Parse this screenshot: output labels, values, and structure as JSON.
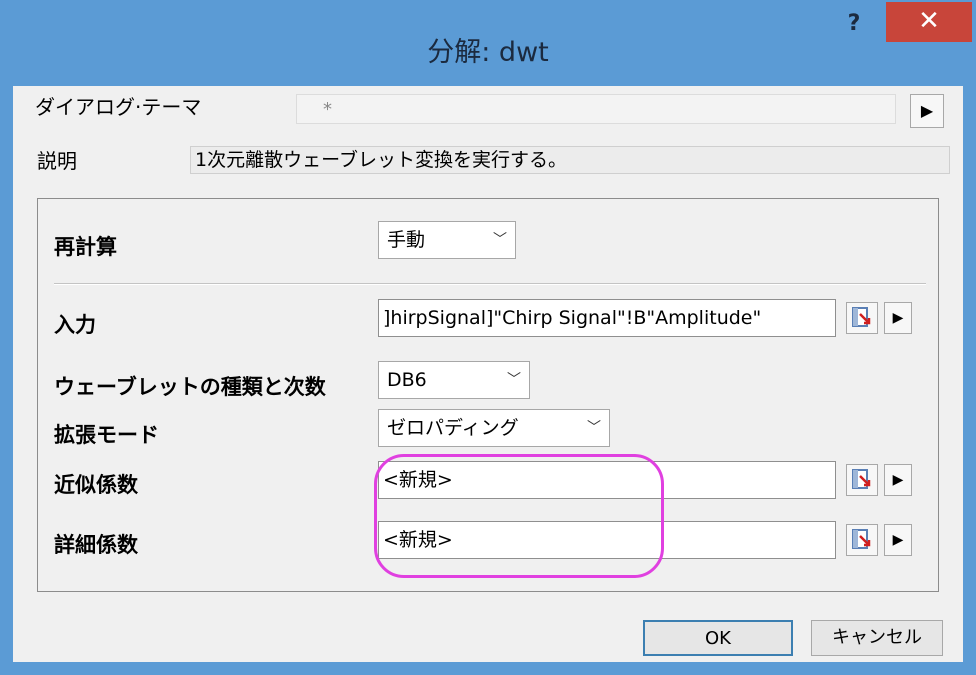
{
  "window": {
    "title": "分解: dwt",
    "help_label": "?",
    "close_label": "✕"
  },
  "theme": {
    "label": "ダイアログ·テーマ",
    "value": "*",
    "arrow": "▶"
  },
  "description": {
    "label": "説明",
    "value": "1次元離散ウェーブレット変換を実行する。"
  },
  "recalc": {
    "label": "再計算",
    "value": "手動"
  },
  "input": {
    "label": "入力",
    "value": "]hirpSignal]\"Chirp Signal\"!B\"Amplitude\""
  },
  "wavelet": {
    "label": "ウェーブレットの種類と次数",
    "value": "DB6"
  },
  "extension": {
    "label": "拡張モード",
    "value": "ゼロパディング"
  },
  "approx": {
    "label": "近似係数",
    "value": "<新規>"
  },
  "detail": {
    "label": "詳細係数",
    "value": "<新規>"
  },
  "buttons": {
    "ok": "OK",
    "cancel": "キャンセル"
  },
  "icons": {
    "combo": "chevron-down-icon",
    "picker": "range-picker-icon",
    "arrow": "triangle-right-icon"
  },
  "colors": {
    "titlebar": "#5b9bd5",
    "close": "#c8453a",
    "highlight": "#e040e0"
  }
}
